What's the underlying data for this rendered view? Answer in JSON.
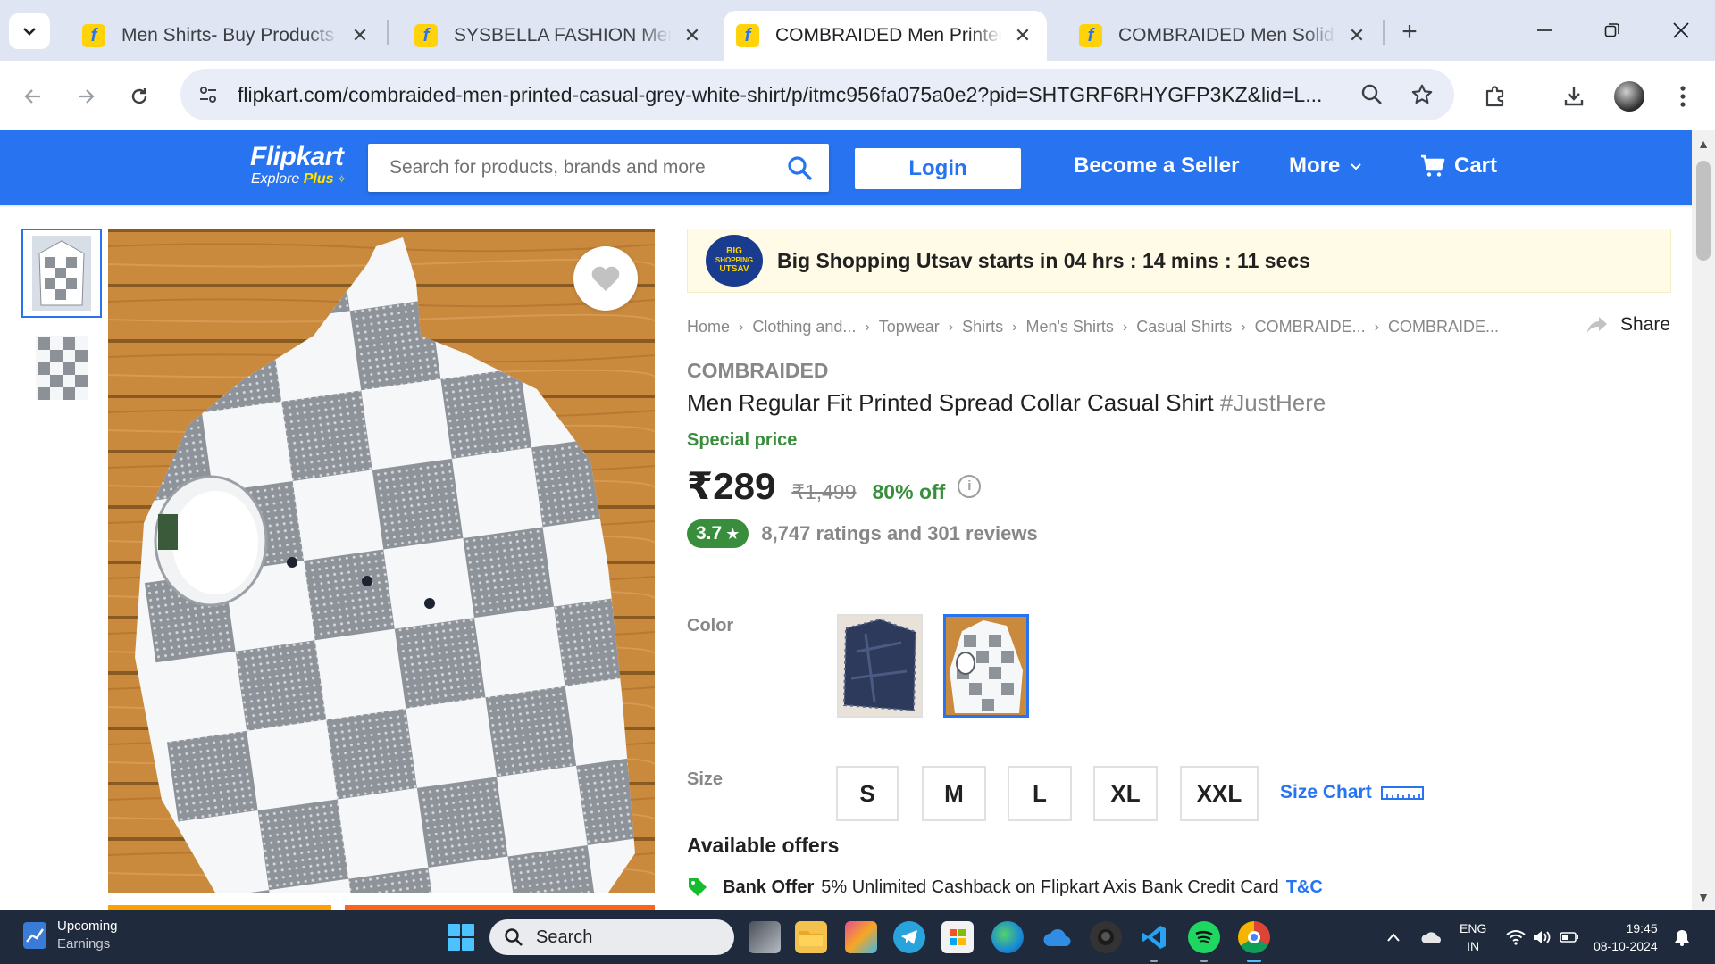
{
  "browser": {
    "tabs": [
      {
        "title": "Men Shirts- Buy Products Online at Best Price in India",
        "active": false
      },
      {
        "title": "SYSBELLA FASHION Men Printed Casual Shirt",
        "active": false
      },
      {
        "title": "COMBRAIDED Men Printed Casual Shirt",
        "active": true
      },
      {
        "title": "COMBRAIDED Men Solid Casual Shirt",
        "active": false
      }
    ],
    "url": "flipkart.com/combraided-men-printed-casual-grey-white-shirt/p/itmc956fa075a0e2?pid=SHTGRF6RHYGFP3KZ&lid=L...",
    "favicon_letter": "f",
    "new_tab": "+",
    "close_glyph": "✕"
  },
  "header": {
    "logo": "Flipkart",
    "logo_sub": "Explore",
    "logo_plus": "Plus",
    "search_placeholder": "Search for products, brands and more",
    "login_label": "Login",
    "seller_label": "Become a Seller",
    "more_label": "More",
    "cart_label": "Cart"
  },
  "banner": {
    "badge_line1": "BIG",
    "badge_line2": "SHOPPING",
    "badge_line3": "UTSAV",
    "text": "Big Shopping Utsav starts in 04 hrs : 14 mins : 11 secs"
  },
  "breadcrumb": [
    "Home",
    "Clothing and...",
    "Topwear",
    "Shirts",
    "Men's Shirts",
    "Casual Shirts",
    "COMBRAIDE...",
    "COMBRAIDE..."
  ],
  "share_label": "Share",
  "product": {
    "brand": "COMBRAIDED",
    "title": "Men Regular Fit Printed Spread Collar Casual Shirt",
    "hashtag": "#JustHere",
    "special_label": "Special price",
    "price": "₹289",
    "mrp": "₹1,499",
    "discount": "80% off",
    "rating": "3.7",
    "rating_star": "★",
    "ratings_text": "8,747 ratings and 301 reviews",
    "color_label": "Color",
    "size_label": "Size",
    "sizes": [
      "S",
      "M",
      "L",
      "XL",
      "XXL"
    ],
    "size_chart_label": "Size Chart",
    "offers_title": "Available offers",
    "offer_kind": "Bank Offer",
    "offer_text": "5% Unlimited Cashback on Flipkart Axis Bank Credit Card",
    "offer_tnc": "T&C"
  },
  "taskbar": {
    "widget_title": "Upcoming",
    "widget_sub": "Earnings",
    "search_label": "Search",
    "lang_line1": "ENG",
    "lang_line2": "IN",
    "time": "19:45",
    "date": "08-10-2024"
  },
  "colors": {
    "flipkart_blue": "#2874f0",
    "green": "#388e3c",
    "taskbar": "#1f2a3c"
  }
}
